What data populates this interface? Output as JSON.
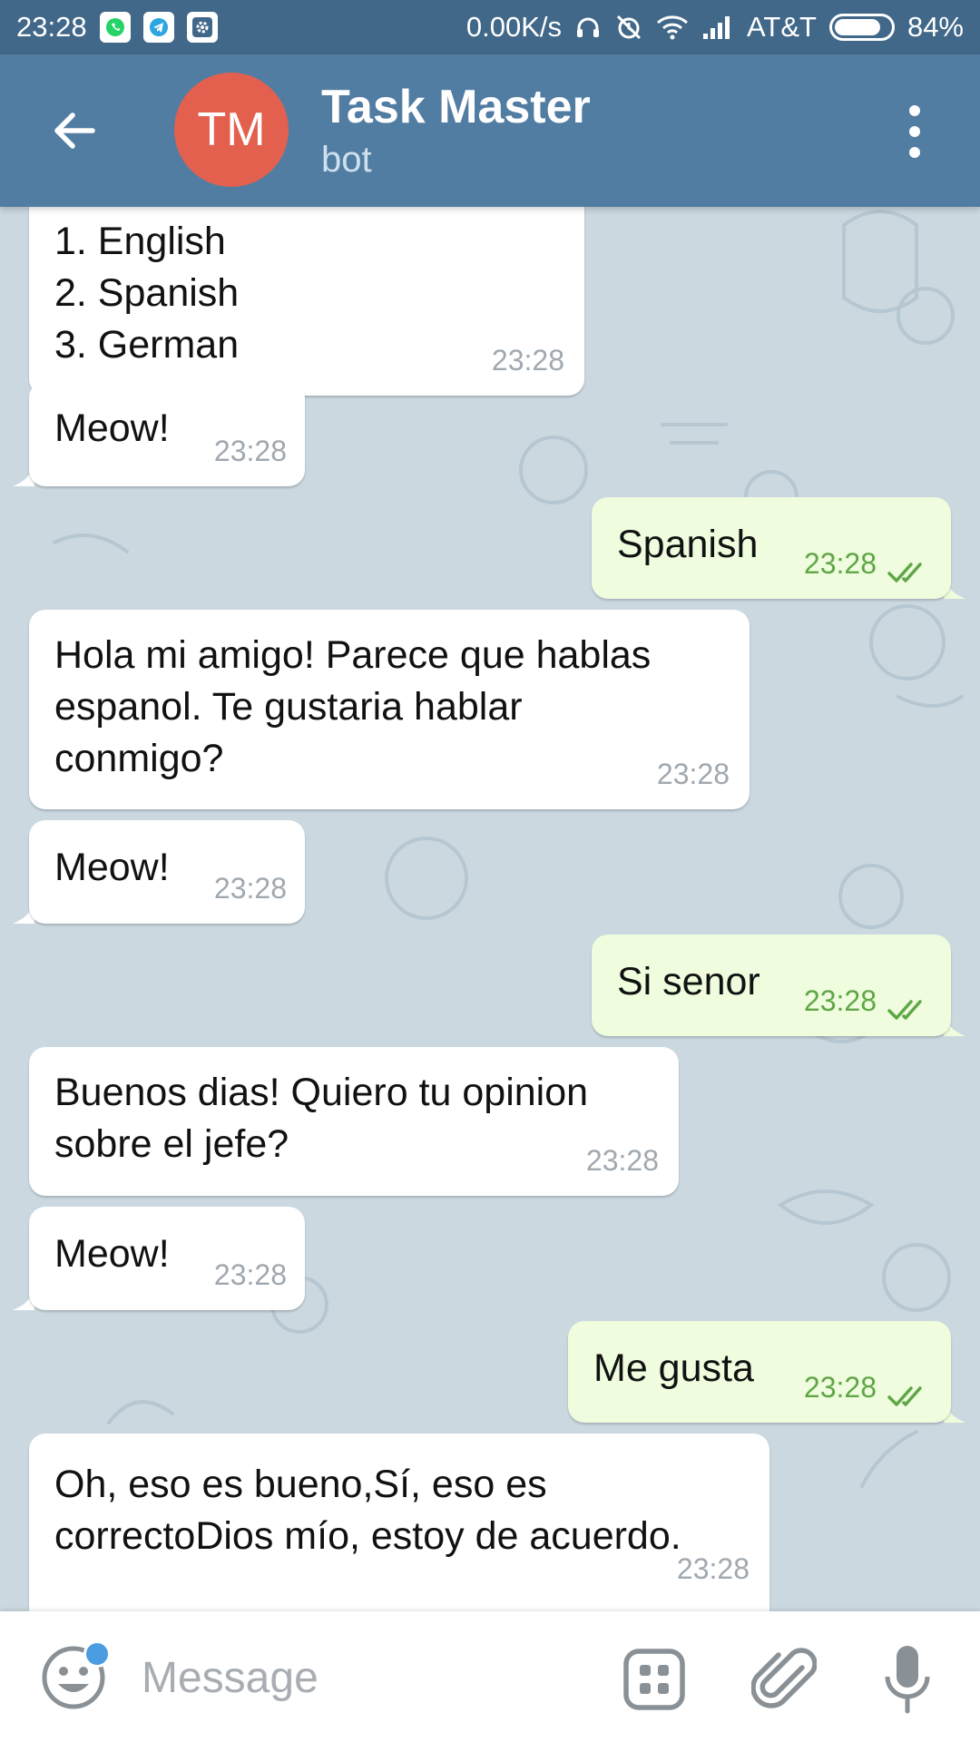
{
  "status_bar": {
    "time": "23:28",
    "net_speed": "0.00K/s",
    "carrier": "AT&T",
    "battery": "84%",
    "battery_level": 0.84,
    "notification_icons": [
      "whatsapp-icon",
      "telegram-icon",
      "settings-icon"
    ],
    "status_icons": [
      "headphones-icon",
      "alarm-off-icon",
      "wifi-icon",
      "signal-icon"
    ]
  },
  "header": {
    "avatar_initials": "TM",
    "title": "Task Master",
    "subtitle": "bot",
    "back_icon": "arrow-left-icon",
    "menu_icon": "more-vertical-icon"
  },
  "messages": [
    {
      "direction": "in",
      "text": "1. English\n2. Spanish\n3. German",
      "time": "23:28"
    },
    {
      "direction": "in",
      "text": "Meow!",
      "time": "23:28"
    },
    {
      "direction": "out",
      "text": "Spanish",
      "time": "23:28",
      "read": true
    },
    {
      "direction": "in",
      "text": "Hola mi amigo! Parece que hablas\nespanol. Te gustaria hablar\nconmigo?",
      "time": "23:28"
    },
    {
      "direction": "in",
      "text": "Meow!",
      "time": "23:28"
    },
    {
      "direction": "out",
      "text": "Si senor",
      "time": "23:28",
      "read": true
    },
    {
      "direction": "in",
      "text": "Buenos dias! Quiero tu opinion\nsobre el jefe?",
      "time": "23:28"
    },
    {
      "direction": "in",
      "text": "Meow!",
      "time": "23:28"
    },
    {
      "direction": "out",
      "text": "Me gusta",
      "time": "23:28",
      "read": true
    },
    {
      "direction": "in",
      "text": "Oh, eso es bueno,Sí, eso es\ncorrectoDios mío, estoy de acuerdo.",
      "time": "23:28"
    }
  ],
  "input_bar": {
    "placeholder": "Message",
    "emoji_icon": "smiley-icon",
    "bot_commands_icon": "bot-commands-icon",
    "attach_icon": "paperclip-icon",
    "mic_icon": "microphone-icon"
  },
  "colors": {
    "status_bar": "#416889",
    "header": "#527da3",
    "avatar": "#e3604e",
    "outgoing_bubble": "#effdde",
    "incoming_bubble": "#ffffff",
    "outgoing_time": "#5fa646",
    "chat_background": "#cbd8e0"
  }
}
